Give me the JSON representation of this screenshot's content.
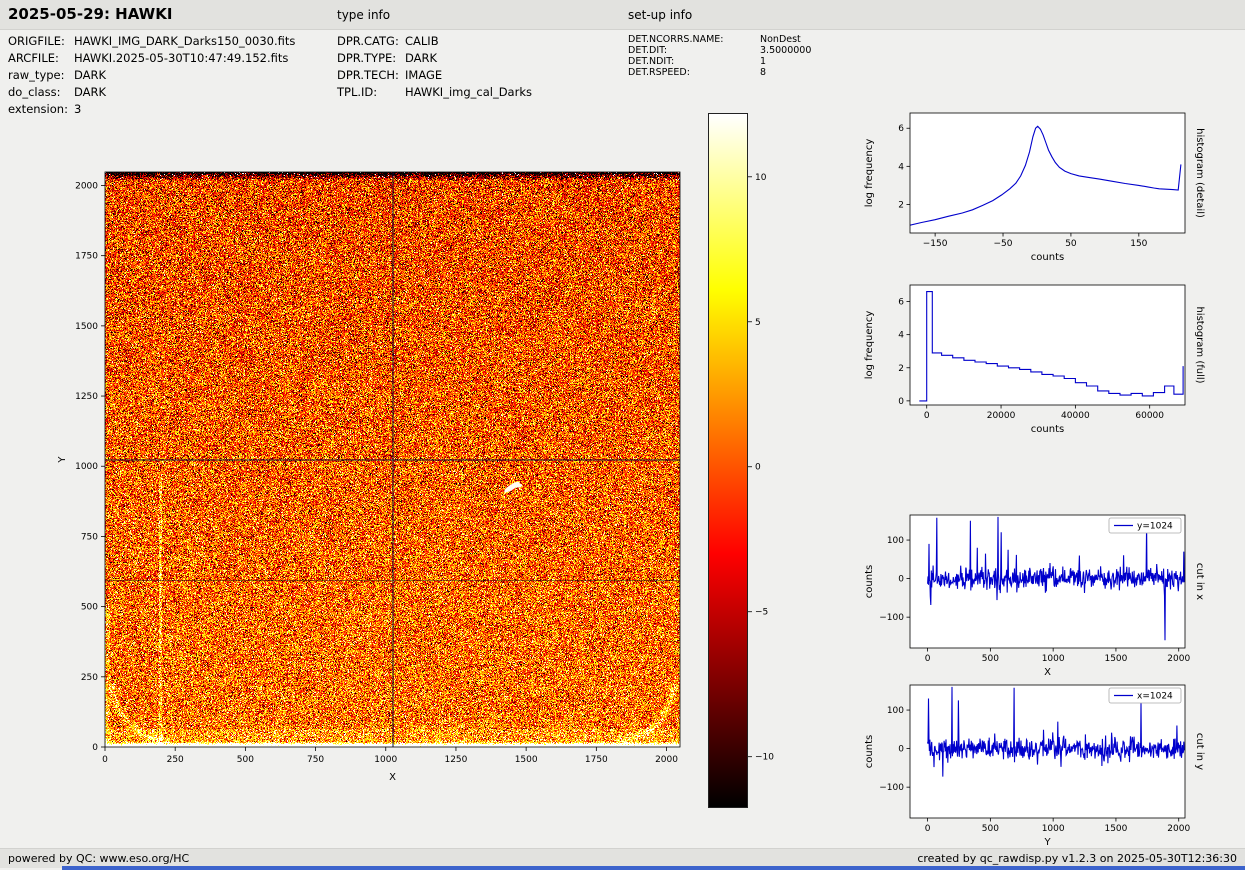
{
  "header": {
    "title": "2025-05-29: HAWKI",
    "sections": {
      "type_info": "type info",
      "setup_info": "set-up info"
    }
  },
  "metadata": {
    "file_info": [
      {
        "label": "ORIGFILE:",
        "value": "HAWKI_IMG_DARK_Darks150_0030.fits"
      },
      {
        "label": "ARCFILE:",
        "value": "HAWKI.2025-05-30T10:47:49.152.fits"
      },
      {
        "label": "raw_type:",
        "value": "DARK"
      },
      {
        "label": "do_class:",
        "value": "DARK"
      },
      {
        "label": "extension:",
        "value": "3"
      }
    ],
    "type_info": [
      {
        "label": "DPR.CATG:",
        "value": "CALIB"
      },
      {
        "label": "DPR.TYPE:",
        "value": "DARK"
      },
      {
        "label": "DPR.TECH:",
        "value": "IMAGE"
      },
      {
        "label": "TPL.ID:",
        "value": "HAWKI_img_cal_Darks"
      }
    ],
    "setup_info": [
      {
        "label": "DET.NCORRS.NAME:",
        "value": "NonDest"
      },
      {
        "label": "DET.DIT:",
        "value": "3.5000000"
      },
      {
        "label": "DET.NDIT:",
        "value": "1"
      },
      {
        "label": "DET.RSPEED:",
        "value": "8"
      }
    ]
  },
  "footer": {
    "left": "powered by QC: www.eso.org/HC",
    "right": "created by qc_rawdisp.py v1.2.3 on 2025-05-30T12:36:30"
  },
  "chart_data": [
    {
      "id": "raw_image",
      "type": "heatmap",
      "description": "2048x2048 HAWKI raw dark frame, hot colormap speckle noise; bright band at bottom edge with curved bright corners, dark band at top edge, bright vertical streak near x=200 in lower half, dark crosshair cut lines at x=1024 and y=1024, small white artifact near (1450, 926)",
      "xlabel": "X",
      "ylabel": "Y",
      "xlim": [
        0,
        2048
      ],
      "ylim": [
        0,
        2048
      ],
      "xticks": [
        0,
        250,
        500,
        750,
        1000,
        1250,
        1500,
        1750,
        2000
      ],
      "yticks": [
        0,
        250,
        500,
        750,
        1000,
        1250,
        1500,
        1750,
        2000
      ],
      "colormap": "hot",
      "vmin": -11.7,
      "vmax": 12.2,
      "noise_sigma": 4.8,
      "crosshair_x": 1024,
      "crosshair_y": 1024,
      "colorbar_ticks": [
        10,
        5,
        0,
        -5,
        -10
      ]
    },
    {
      "id": "histogram_detail",
      "type": "line",
      "right_label": "histogram (detail)",
      "xlabel": "counts",
      "ylabel": "log frequency",
      "xlim": [
        -187,
        218
      ],
      "ylim": [
        0.5,
        6.8
      ],
      "xticks": [
        -150,
        -50,
        50,
        150
      ],
      "yticks": [
        2,
        4,
        6
      ],
      "line_color": "#0000cc",
      "x": [
        -188,
        -170,
        -150,
        -130,
        -110,
        -95,
        -80,
        -65,
        -52,
        -40,
        -31,
        -24,
        -17,
        -11,
        -6,
        -2,
        1,
        5,
        9,
        13,
        17,
        22,
        27,
        33,
        41,
        50,
        62,
        76,
        92,
        110,
        130,
        150,
        163,
        172,
        180,
        190,
        200,
        208,
        212
      ],
      "y": [
        0.9,
        1.05,
        1.2,
        1.38,
        1.55,
        1.72,
        1.95,
        2.2,
        2.5,
        2.82,
        3.12,
        3.5,
        4.05,
        4.75,
        5.55,
        6.0,
        6.1,
        5.95,
        5.65,
        5.25,
        4.85,
        4.5,
        4.2,
        3.95,
        3.75,
        3.62,
        3.5,
        3.42,
        3.33,
        3.22,
        3.1,
        3.0,
        2.92,
        2.86,
        2.82,
        2.8,
        2.78,
        2.76,
        4.1
      ]
    },
    {
      "id": "histogram_full",
      "type": "line",
      "step": true,
      "right_label": "histogram (full)",
      "xlabel": "counts",
      "ylabel": "log frequency",
      "xlim": [
        -4500,
        69500
      ],
      "ylim": [
        -0.25,
        7.0
      ],
      "xticks": [
        0,
        20000,
        40000,
        60000
      ],
      "yticks": [
        0,
        2,
        4,
        6
      ],
      "line_color": "#0000cc",
      "x": [
        -2000,
        0,
        1500,
        4000,
        7000,
        10000,
        13000,
        16000,
        19000,
        22000,
        25000,
        28000,
        31000,
        34000,
        37000,
        40000,
        43000,
        46000,
        49000,
        52000,
        55000,
        58000,
        61000,
        64000,
        66500,
        69000
      ],
      "y": [
        0,
        6.6,
        2.9,
        2.75,
        2.6,
        2.45,
        2.35,
        2.25,
        2.1,
        2.0,
        1.9,
        1.75,
        1.6,
        1.5,
        1.35,
        1.1,
        0.9,
        0.6,
        0.45,
        0.35,
        0.45,
        0.3,
        0.5,
        0.9,
        0.4,
        2.1
      ]
    },
    {
      "id": "cut_x",
      "type": "line",
      "right_label": "cut in x",
      "legend": "y=1024",
      "xlabel": "X",
      "ylabel": "counts",
      "xlim": [
        -140,
        2050
      ],
      "ylim": [
        -180,
        165
      ],
      "xticks": [
        0,
        500,
        1000,
        1500,
        2000
      ],
      "yticks": [
        -100,
        0,
        100
      ],
      "line_color": "#0000cc",
      "noise_sigma": 14,
      "n_points": 560,
      "seed": 42,
      "spikes": [
        {
          "x": 12,
          "v": 90
        },
        {
          "x": 75,
          "v": 158
        },
        {
          "x": 340,
          "v": 150
        },
        {
          "x": 395,
          "v": 80
        },
        {
          "x": 560,
          "v": 160
        },
        {
          "x": 585,
          "v": 120
        },
        {
          "x": 640,
          "v": 75
        },
        {
          "x": 1210,
          "v": 60
        },
        {
          "x": 1745,
          "v": 140
        },
        {
          "x": 1890,
          "v": -160
        },
        {
          "x": 2040,
          "v": 70
        }
      ]
    },
    {
      "id": "cut_y",
      "type": "line",
      "right_label": "cut in y",
      "legend": "x=1024",
      "xlabel": "Y",
      "ylabel": "counts",
      "xlim": [
        -140,
        2050
      ],
      "ylim": [
        -180,
        165
      ],
      "xticks": [
        0,
        500,
        1000,
        1500,
        2000
      ],
      "yticks": [
        -100,
        0,
        100
      ],
      "line_color": "#0000cc",
      "noise_sigma": 14,
      "n_points": 560,
      "seed": 77,
      "spikes": [
        {
          "x": 8,
          "v": 130
        },
        {
          "x": 195,
          "v": 160
        },
        {
          "x": 245,
          "v": 125
        },
        {
          "x": 690,
          "v": 158
        },
        {
          "x": 1035,
          "v": 70
        },
        {
          "x": 1700,
          "v": 120
        },
        {
          "x": 1985,
          "v": 60
        }
      ]
    }
  ]
}
